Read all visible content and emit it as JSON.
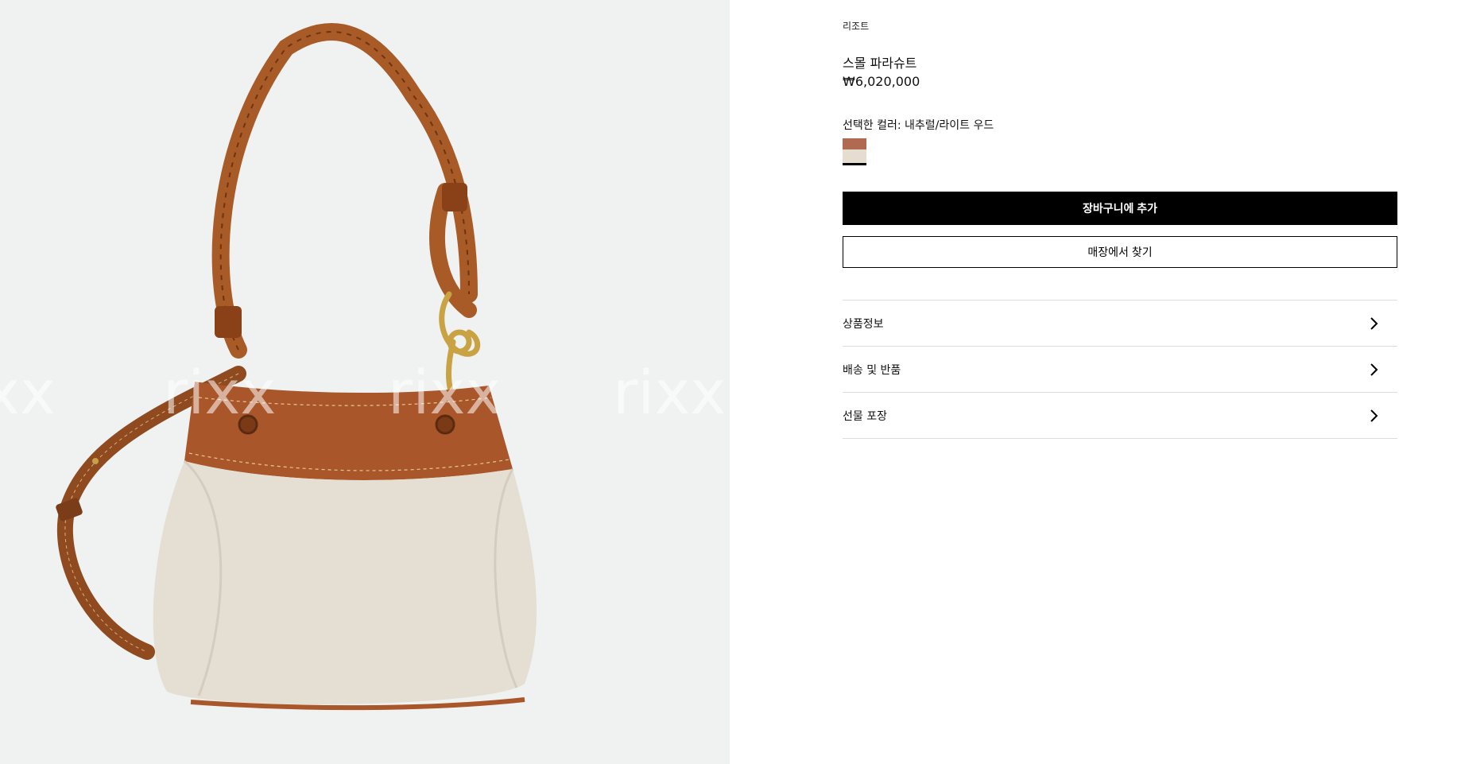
{
  "gallery": {
    "watermark_text": "rixx",
    "background_color": "#f0f2f1",
    "product_image_alt": "스몰 파라슈트"
  },
  "product": {
    "category": "리조트",
    "title": "스몰 파라슈트",
    "price": "₩6,020,000",
    "selected_color_label": "선택한 컬러: 내추럴/라이트 우드",
    "swatch_colors": {
      "top": "#b16a52",
      "bottom": "#e6ddd1"
    }
  },
  "actions": {
    "add_to_cart": "장바구니에 추가",
    "find_in_store": "매장에서 찾기"
  },
  "accordion": {
    "items": [
      {
        "label": "상품정보",
        "icon": "chevron-right-icon"
      },
      {
        "label": "배송 및 반품",
        "icon": "chevron-right-icon"
      },
      {
        "label": "선물 포장",
        "icon": "chevron-right-icon"
      }
    ]
  }
}
